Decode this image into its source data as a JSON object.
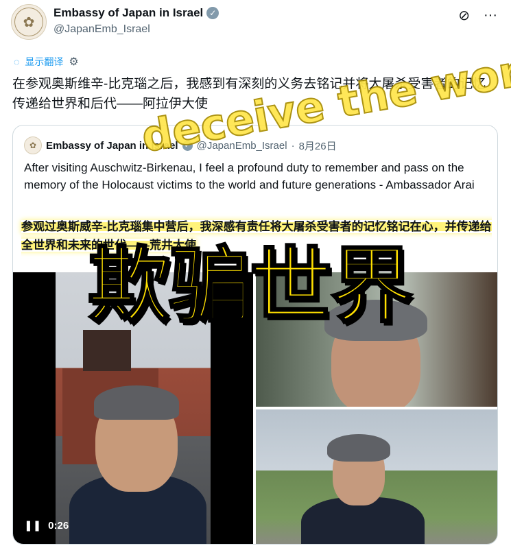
{
  "author": {
    "name": "Embassy of Japan in Israel",
    "handle": "@JapanEmb_Israel"
  },
  "translate": {
    "label": "显示翻译"
  },
  "tweet": {
    "text": "在参观奥斯维辛-比克瑙之后，我感到有深刻的义务去铭记并将大屠杀受害者的记忆传递给世界和后代——阿拉伊大使"
  },
  "quoted": {
    "name": "Embassy of Japan in Israel",
    "handle": "@JapanEmb_Israel",
    "separator": "·",
    "date": "8月26日",
    "text_en": "After visiting Auschwitz-Birkenau, I feel a profound duty to remember and pass on the memory of the Holocaust victims to the world and future generations - Ambassador Arai",
    "text_zh": "参观过奥斯威辛-比克瑙集中营后，我深感有责任将大屠杀受害者的记忆铭记在心，并传递给全世界和未来的世代——荒井大使"
  },
  "video": {
    "time": "0:26"
  },
  "overlay": {
    "big_text": "欺骗世界",
    "rotated_text": "deceive the world"
  },
  "icons": {
    "verified": "verified-badge-icon",
    "grok": "grok-icon",
    "more": "more-icon",
    "translate": "translate-icon",
    "settings": "gear-icon",
    "pause": "pause-icon"
  }
}
